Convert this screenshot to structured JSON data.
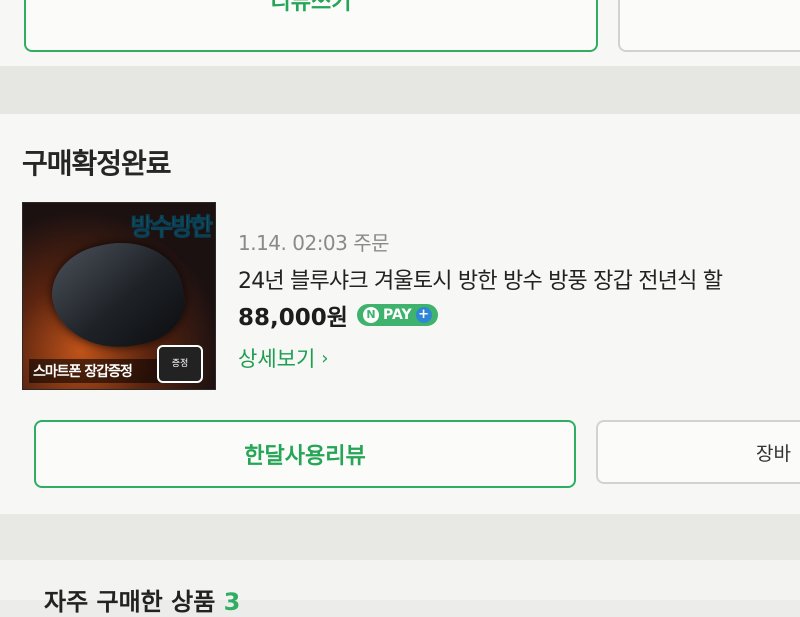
{
  "previous_card": {
    "button_label": "리뷰쓰기"
  },
  "order": {
    "status_title": "구매확정완료",
    "thumbnail": {
      "badge_text": "방수방한",
      "caption": "스마트폰 장갑증정",
      "sticker_text": "증정"
    },
    "order_date": "1.14. 02:03 주문",
    "product_name": "24년 블루샤크 겨울토시 방한 방수 방풍 장갑 전년식 할",
    "price": "88,000원",
    "pay_badge": "PAY",
    "pay_badge_n": "N",
    "pay_badge_plus": "+",
    "detail_link": "상세보기",
    "detail_chevron": "›",
    "review_button": "한달사용리뷰",
    "right_button": "장바"
  },
  "frequent": {
    "title": "자주 구매한 상품",
    "count": "3"
  },
  "colors": {
    "accent_green": "#2fae63",
    "npay_green": "#3fb36d",
    "plus_blue": "#2d86d6"
  }
}
